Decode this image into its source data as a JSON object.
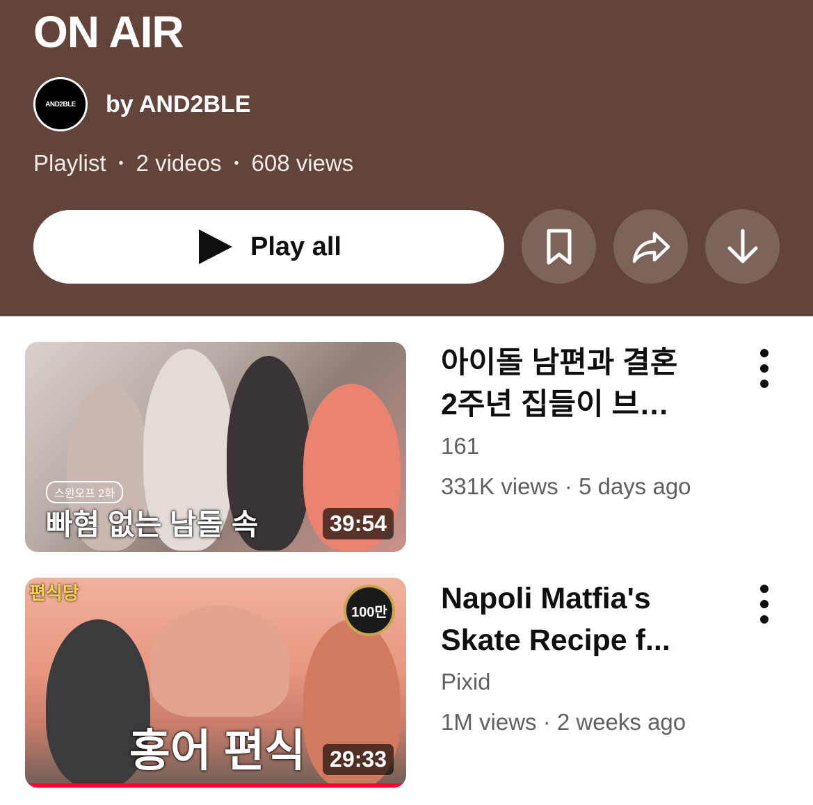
{
  "playlist": {
    "title": "ON AIR",
    "channel": "by AND2BLE",
    "avatar_text": "AND2BLE",
    "meta": [
      "Playlist",
      "2 videos",
      "608 views"
    ],
    "play_all_label": "Play all"
  },
  "actions": {
    "icons": [
      "bookmark-icon",
      "share-icon",
      "download-icon"
    ]
  },
  "colors": {
    "header_bg": "#63443a",
    "round_button_bg": "#7d645b",
    "progress": "#ff0033"
  },
  "videos": [
    {
      "title_line1": "아이돌 남편과 결혼",
      "title_line2": "2주년 집들이 브…",
      "author": "161",
      "stats": "331K views · 5 days ago",
      "duration": "39:54",
      "thumb_caption": "빠혐 없는 남돌 속",
      "thumb_tag": "스윈오프 2화"
    },
    {
      "title_line1": "Napoli Matfia's",
      "title_line2": "Skate Recipe f...",
      "author": "Pixid",
      "stats": "1M views · 2 weeks ago",
      "duration": "29:33",
      "thumb_caption": "홍어 편식",
      "thumb_brand": "편식당",
      "thumb_badge": "100만",
      "watched_fraction": 1.0
    }
  ]
}
